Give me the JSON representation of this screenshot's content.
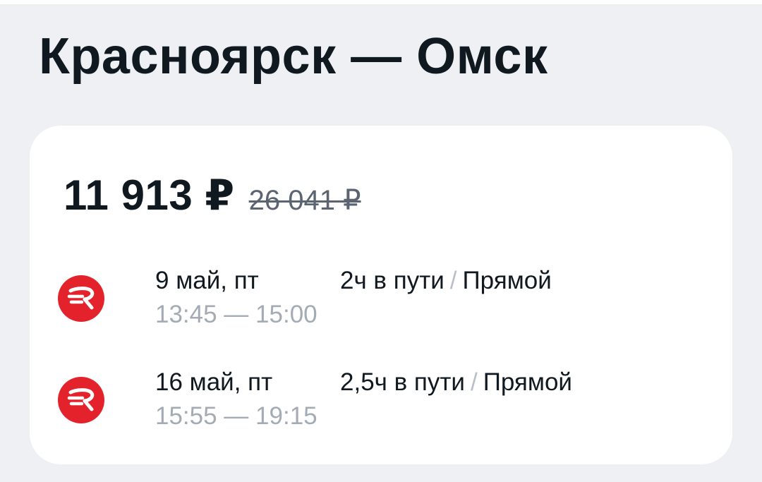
{
  "route": {
    "title": "Красноярск — Омск"
  },
  "offer": {
    "price": "11 913 ₽",
    "old_price": "26 041 ₽",
    "accent_color": "#e3222b",
    "flights": [
      {
        "airline_icon": "red-circle-r-logo-icon",
        "date": "9 май, пт",
        "time": "13:45 — 15:00",
        "duration": "2ч в пути",
        "separator": "/",
        "type": "Прямой"
      },
      {
        "airline_icon": "red-circle-r-logo-icon",
        "date": "16 май, пт",
        "time": "15:55 — 19:15",
        "duration": "2,5ч в пути",
        "separator": "/",
        "type": "Прямой"
      }
    ]
  }
}
